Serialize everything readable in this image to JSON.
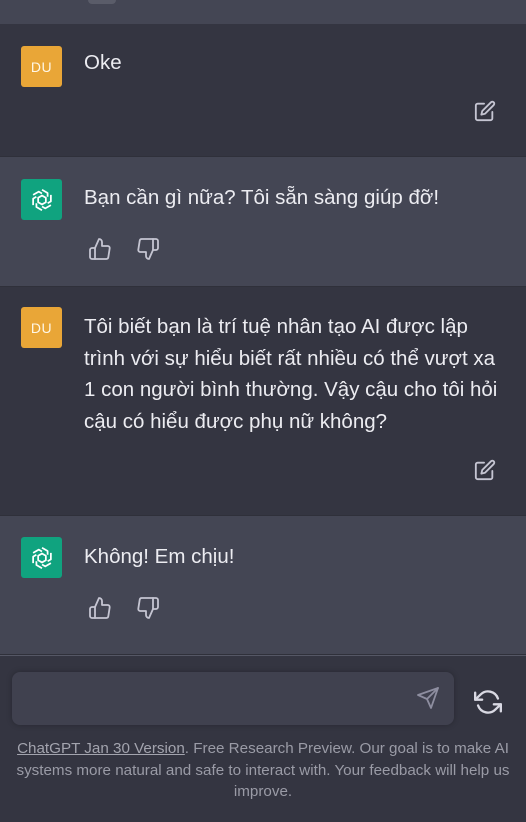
{
  "messages": [
    {
      "role": "user",
      "avatar": "DU",
      "text": "Oke"
    },
    {
      "role": "assistant",
      "text": "Bạn cần gì nữa? Tôi sẵn sàng giúp đỡ!"
    },
    {
      "role": "user",
      "avatar": "DU",
      "text": "Tôi biết bạn là trí tuệ nhân tạo AI được lập trình với sự hiểu biết rất nhiều có thể vượt xa 1 con người bình thường. Vậy cậu cho tôi hỏi cậu có hiểu được phụ nữ không?"
    },
    {
      "role": "assistant",
      "text": "Không! Em chịu!"
    }
  ],
  "composer": {
    "value": "",
    "placeholder": ""
  },
  "footer": {
    "link_text": "ChatGPT Jan 30 Version",
    "text": ". Free Research Preview. Our goal is to make AI systems more natural and safe to interact with. Your feedback will help us improve."
  },
  "colors": {
    "background": "#343541",
    "assistant_background": "#444654",
    "user_avatar": "#e9a637",
    "assistant_avatar": "#10a37f",
    "text": "#ececf1"
  },
  "icons": {
    "edit": "edit-icon",
    "thumbs_up": "thumbs-up-icon",
    "thumbs_down": "thumbs-down-icon",
    "send": "send-icon",
    "regenerate": "regenerate-icon",
    "assistant_logo": "openai-logo-icon"
  }
}
